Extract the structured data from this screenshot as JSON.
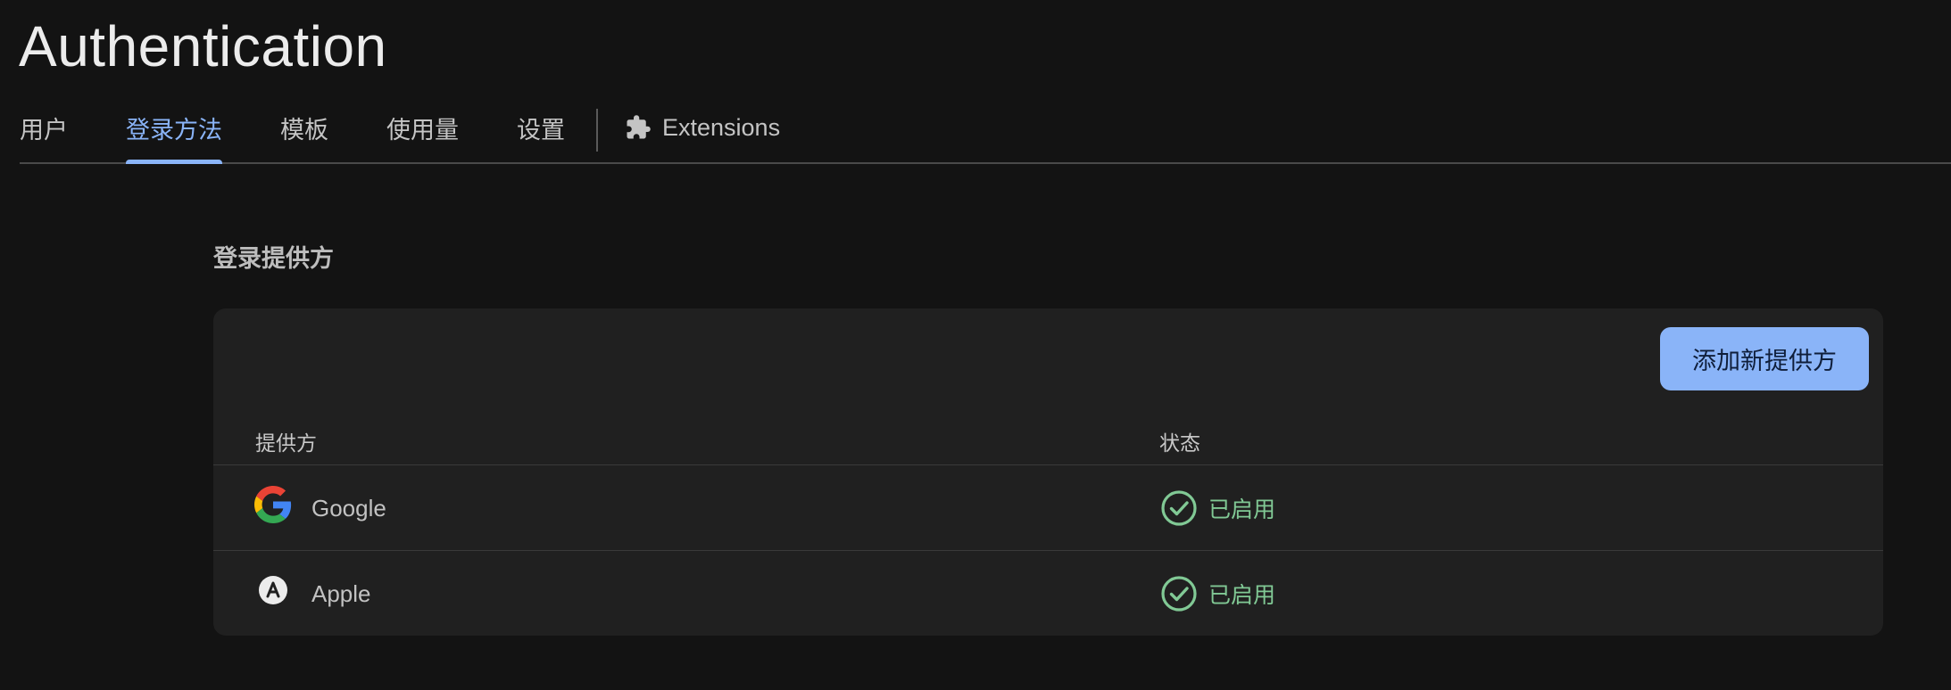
{
  "page": {
    "title": "Authentication"
  },
  "tabs": [
    {
      "label": "用户",
      "active": false
    },
    {
      "label": "登录方法",
      "active": true
    },
    {
      "label": "模板",
      "active": false
    },
    {
      "label": "使用量",
      "active": false
    },
    {
      "label": "设置",
      "active": false
    },
    {
      "label": "Extensions",
      "active": false,
      "icon": "puzzle-icon"
    }
  ],
  "section": {
    "heading": "登录提供方"
  },
  "providers_card": {
    "add_button_label": "添加新提供方",
    "columns": {
      "provider": "提供方",
      "status": "状态"
    },
    "rows": [
      {
        "provider": "Google",
        "icon": "google-logo-icon",
        "status": "已启用",
        "status_icon": "check-circle-icon"
      },
      {
        "provider": "Apple",
        "icon": "apple-app-store-icon",
        "status": "已启用",
        "status_icon": "check-circle-icon"
      }
    ]
  },
  "colors": {
    "background": "#131313",
    "card": "#202020",
    "accent": "#8ab4f8",
    "success": "#81c995"
  }
}
